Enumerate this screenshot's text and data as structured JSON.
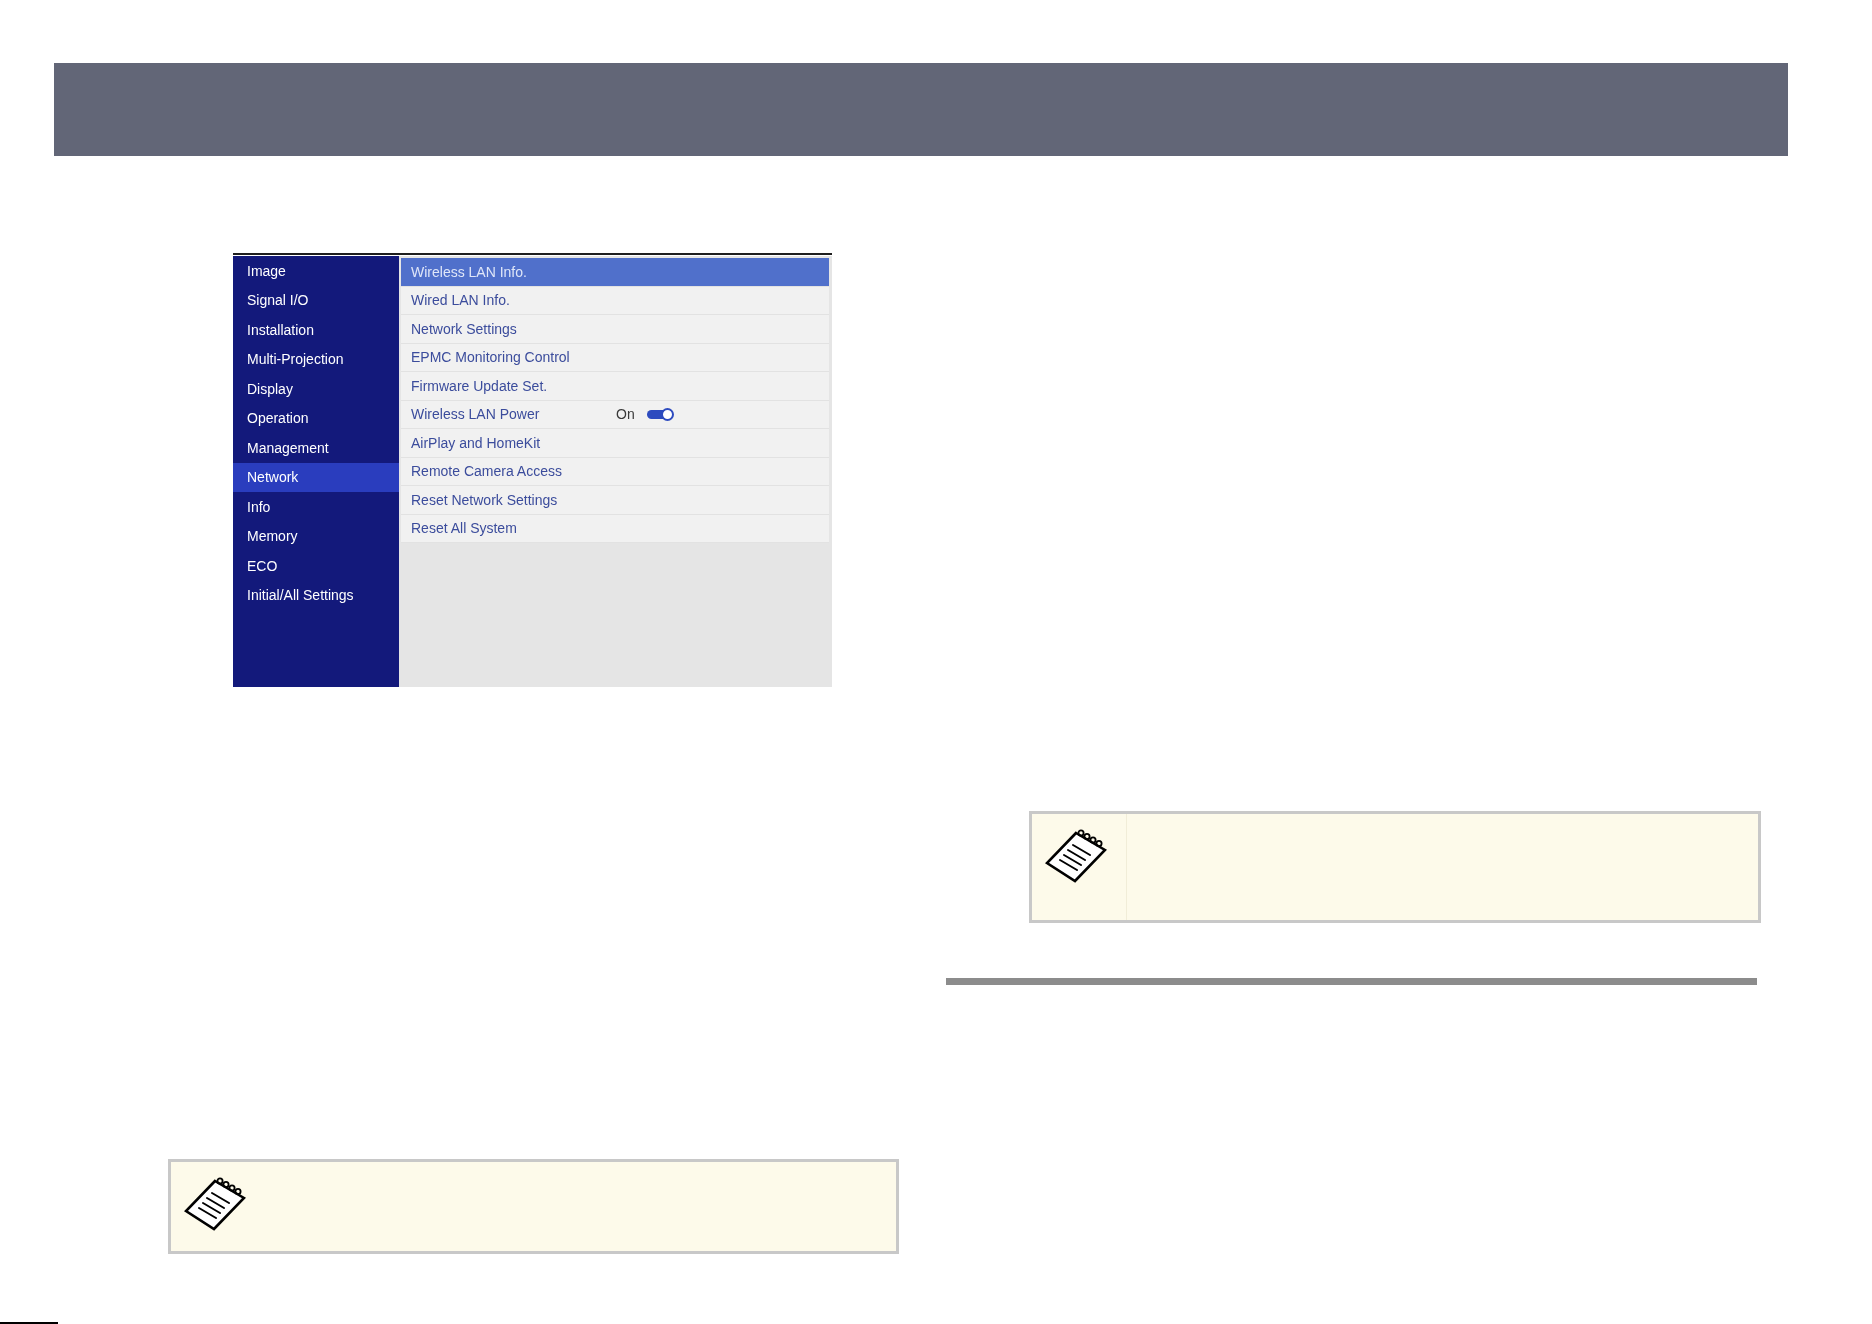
{
  "menu": {
    "sidebar": [
      {
        "label": "Image",
        "selected": false
      },
      {
        "label": "Signal I/O",
        "selected": false
      },
      {
        "label": "Installation",
        "selected": false
      },
      {
        "label": "Multi-Projection",
        "selected": false
      },
      {
        "label": "Display",
        "selected": false
      },
      {
        "label": "Operation",
        "selected": false
      },
      {
        "label": "Management",
        "selected": false
      },
      {
        "label": "Network",
        "selected": true
      },
      {
        "label": "Info",
        "selected": false
      },
      {
        "label": "Memory",
        "selected": false
      },
      {
        "label": "ECO",
        "selected": false
      },
      {
        "label": "Initial/All Settings",
        "selected": false
      }
    ],
    "items": [
      {
        "kind": "link",
        "label": "Wireless LAN Info.",
        "selected": true
      },
      {
        "kind": "link",
        "label": "Wired LAN Info.",
        "selected": false
      },
      {
        "kind": "link",
        "label": "Network Settings",
        "selected": false
      },
      {
        "kind": "link",
        "label": "EPMC Monitoring Control",
        "selected": false
      },
      {
        "kind": "link",
        "label": "Firmware Update Set.",
        "selected": false
      },
      {
        "kind": "toggle",
        "label": "Wireless LAN Power",
        "value": "On",
        "on": true,
        "selected": false
      },
      {
        "kind": "link",
        "label": "AirPlay and HomeKit",
        "selected": false
      },
      {
        "kind": "link",
        "label": "Remote Camera Access",
        "selected": false
      },
      {
        "kind": "link",
        "label": "Reset Network Settings",
        "selected": false
      },
      {
        "kind": "link",
        "label": "Reset All System",
        "selected": false
      }
    ]
  }
}
